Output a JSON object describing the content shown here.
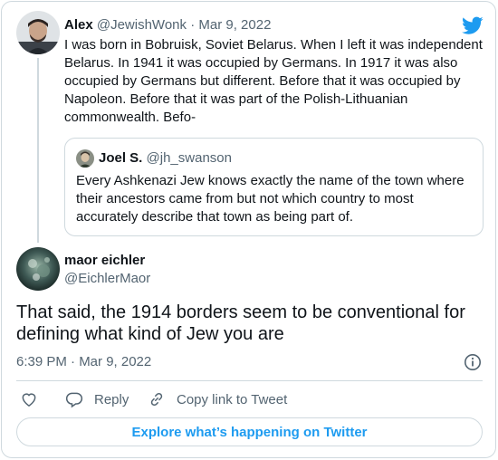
{
  "colors": {
    "brand": "#1d9bf0",
    "text": "#0f1419",
    "muted": "#536471",
    "border": "#cfd9de"
  },
  "parent_tweet": {
    "name": "Alex",
    "handle": "@JewishWonk",
    "separator": "·",
    "date": "Mar 9, 2022",
    "text": "I was born in Bobruisk, Soviet Belarus. When I left it was independent Belarus. In 1941 it was occupied by Germans. In 1917 it was also occupied by Germans but different. Before that it was occupied by Napoleon. Before that it was part of the Polish-Lithuanian commonwealth. Befo-",
    "quoted_tweet": {
      "name": "Joel S.",
      "handle": "@jh_swanson",
      "text": "Every Ashkenazi Jew knows exactly the name of the town where their ancestors came from but not which country to most accurately describe that town as being part of."
    }
  },
  "main_tweet": {
    "name": "maor eichler",
    "handle": "@EichlerMaor",
    "text": "That said, the 1914 borders seem to be conventional for defining what kind of Jew you are",
    "timestamp": "6:39 PM · Mar 9, 2022"
  },
  "actions": {
    "like_icon": "heart-icon",
    "reply_label": "Reply",
    "copy_link_label": "Copy link to Tweet"
  },
  "explore_button_label": "Explore what’s happening on Twitter",
  "icons": {
    "brand_logo": "twitter-bird-icon",
    "info": "info-icon"
  }
}
